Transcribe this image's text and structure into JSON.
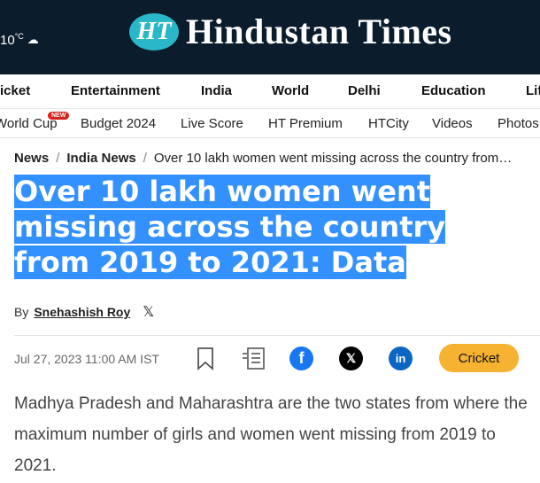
{
  "header": {
    "weather": "10",
    "weather_unit": "°C",
    "logo_badge": "HT",
    "logo_text": "Hindustan Times"
  },
  "nav_primary": [
    "icket",
    "Entertainment",
    "India",
    "World",
    "Delhi",
    "Education",
    "Lif"
  ],
  "nav_secondary": {
    "items": [
      "World Cup",
      "Budget 2024",
      "Live Score",
      "HT Premium",
      "HTCity",
      "Videos",
      "Photos"
    ],
    "new_badge": "NEW"
  },
  "breadcrumb": [
    "News",
    "India News",
    "Over 10 lakh women went missing across the country from…"
  ],
  "article": {
    "headline_lines": [
      "Over 10 lakh women went ",
      "missing across the country ",
      "from 2019 to 2021: Data"
    ],
    "by": "By",
    "author": "Snehashish Roy",
    "date": "Jul 27, 2023 11:00 AM IST",
    "tag": "Cricket",
    "lede": "Madhya Pradesh and Maharashtra are the two states from where the maximum number of girls and women went missing from 2019 to 2021."
  },
  "colors": {
    "header_bg": "#0b1c2c",
    "highlight": "#3391ff",
    "facebook": "#1877f2",
    "linkedin": "#0a66c2",
    "tag_bg": "#f6b331"
  }
}
